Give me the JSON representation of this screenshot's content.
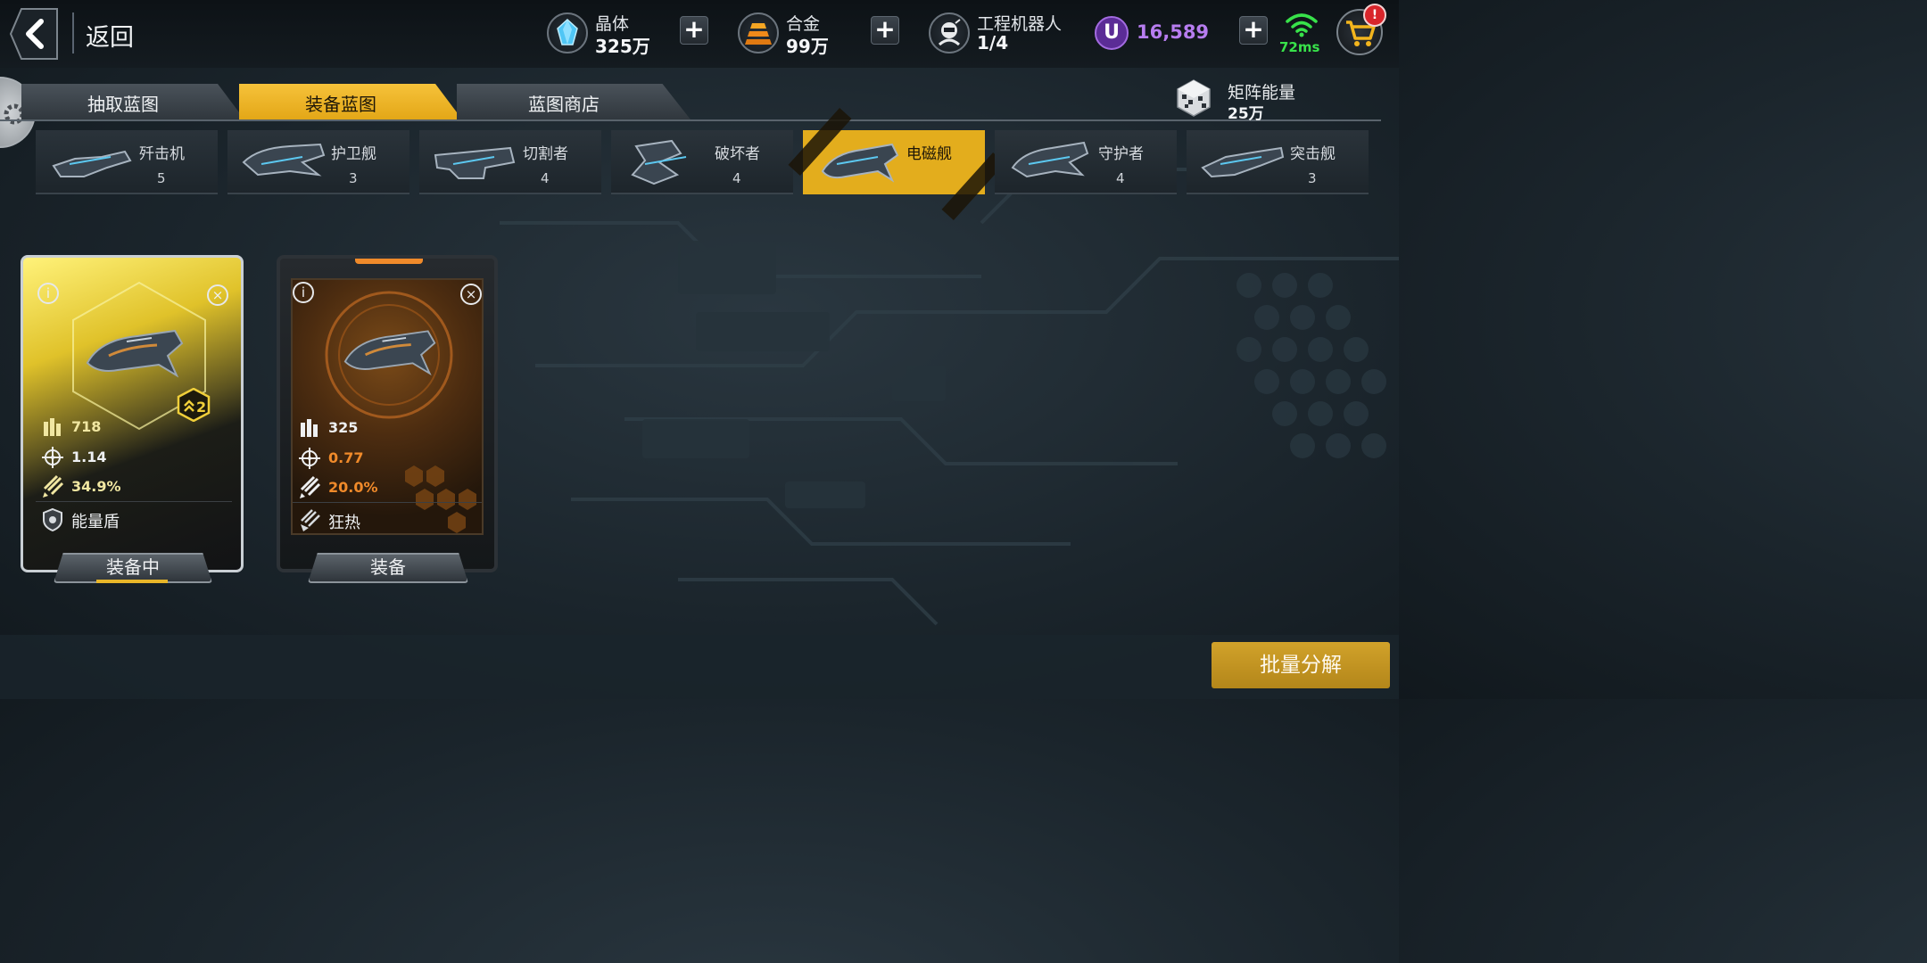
{
  "header": {
    "back_label": "返回",
    "resources": [
      {
        "name": "晶体",
        "value": "325万",
        "icon": "crystal-icon"
      },
      {
        "name": "合金",
        "value": "99万",
        "icon": "alloy-icon"
      },
      {
        "name": "工程机器人",
        "value": "1/4",
        "icon": "robot-icon"
      }
    ],
    "u_symbol": "U",
    "premium_currency": "16,589",
    "ping": "72ms",
    "cart_badge": "!"
  },
  "tabs": [
    {
      "label": "抽取蓝图",
      "active": false
    },
    {
      "label": "装备蓝图",
      "active": true
    },
    {
      "label": "蓝图商店",
      "active": false
    }
  ],
  "matrix_energy": {
    "name": "矩阵能量",
    "value": "25万"
  },
  "ship_types": [
    {
      "name": "歼击机",
      "count": "5",
      "selected": false
    },
    {
      "name": "护卫舰",
      "count": "3",
      "selected": false
    },
    {
      "name": "切割者",
      "count": "4",
      "selected": false
    },
    {
      "name": "破坏者",
      "count": "4",
      "selected": false
    },
    {
      "name": "电磁舰",
      "count": "",
      "selected": true
    },
    {
      "name": "守护者",
      "count": "4",
      "selected": false
    },
    {
      "name": "突击舰",
      "count": "3",
      "selected": false
    }
  ],
  "blueprints": [
    {
      "rank": "2",
      "ammo": "718",
      "accuracy": "1.14",
      "missile": "34.9%",
      "trait": "能量盾",
      "button": "装备中",
      "colors": {
        "ammo": "#f1e7a2",
        "accuracy": "#eef0f2",
        "missile": "#f1e7a2"
      }
    },
    {
      "ammo": "325",
      "accuracy": "0.77",
      "missile": "20.0%",
      "trait": "狂热",
      "button": "装备",
      "colors": {
        "ammo": "#eef0f2",
        "accuracy": "#f08a2a",
        "missile": "#f08a2a"
      }
    }
  ],
  "batch_button": "批量分解",
  "colors": {
    "accent_gold": "#e3ad1d",
    "premium_purple": "#b77df0",
    "ping_green": "#38e24a",
    "rarity_orange": "#f08a2a"
  }
}
